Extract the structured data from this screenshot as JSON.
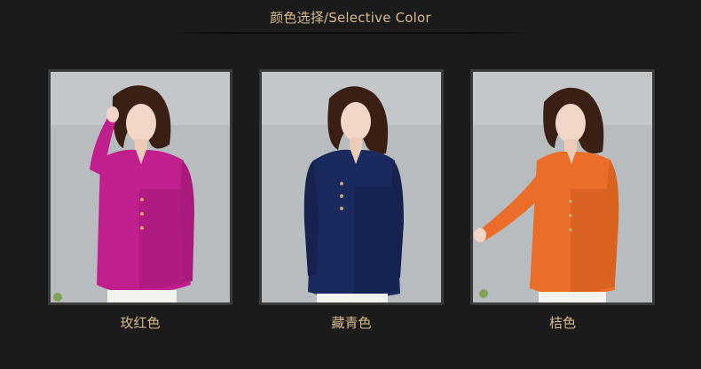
{
  "header": {
    "title": "颜色选择/Selective Color"
  },
  "variants": [
    {
      "label": "玫红色",
      "color": "#c21f8e",
      "shade": "#9c1772"
    },
    {
      "label": "藏青色",
      "color": "#1b2a5e",
      "shade": "#121d45"
    },
    {
      "label": "桔色",
      "color": "#ea6e2a",
      "shade": "#c8561c"
    }
  ],
  "colors": {
    "accent_text": "#d6b98a",
    "background": "#1b1b1b",
    "photo_wall": "#b9bcbf"
  }
}
